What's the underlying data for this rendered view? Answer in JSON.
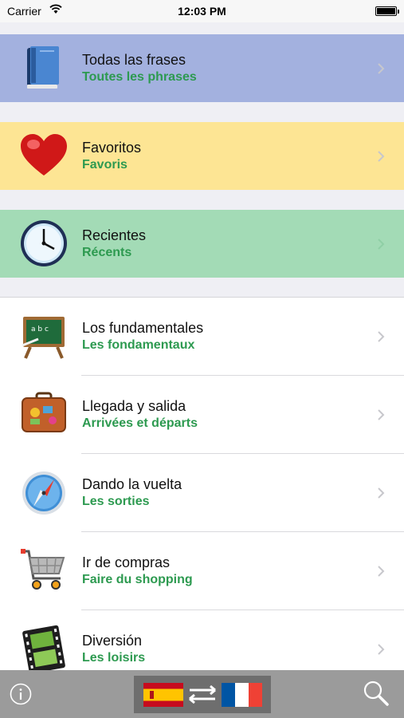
{
  "status_bar": {
    "carrier": "Carrier",
    "time": "12:03 PM"
  },
  "highlight_sections": [
    {
      "title": "Todas las frases",
      "subtitle": "Toutes les phrases",
      "icon": "book-icon",
      "bg_color": "#a3b1df"
    },
    {
      "title": "Favoritos",
      "subtitle": "Favoris",
      "icon": "heart-icon",
      "bg_color": "#fde594"
    },
    {
      "title": "Recientes",
      "subtitle": "Récents",
      "icon": "clock-icon",
      "bg_color": "#a3dbb6"
    }
  ],
  "categories": [
    {
      "title": "Los fundamentales",
      "subtitle": "Les fondamentaux",
      "icon": "chalkboard-icon"
    },
    {
      "title": "Llegada y salida",
      "subtitle": "Arrivées et départs",
      "icon": "suitcase-icon"
    },
    {
      "title": "Dando la vuelta",
      "subtitle": "Les sorties",
      "icon": "compass-icon"
    },
    {
      "title": "Ir de compras",
      "subtitle": "Faire du shopping",
      "icon": "shopping-cart-icon"
    },
    {
      "title": "Diversión",
      "subtitle": "Les loisirs",
      "icon": "film-strip-icon"
    }
  ],
  "tab_bar": {
    "left_icon": "info-icon",
    "center_icon": "language-swap-icon",
    "right_icon": "search-icon"
  },
  "colors": {
    "subtitle_text": "#2d9a50",
    "tab_bar_bg": "#9b9b9b",
    "spain_red": "#c60b1e",
    "spain_yellow": "#ffc400",
    "france_blue": "#0055a4",
    "france_red": "#ef4135"
  }
}
